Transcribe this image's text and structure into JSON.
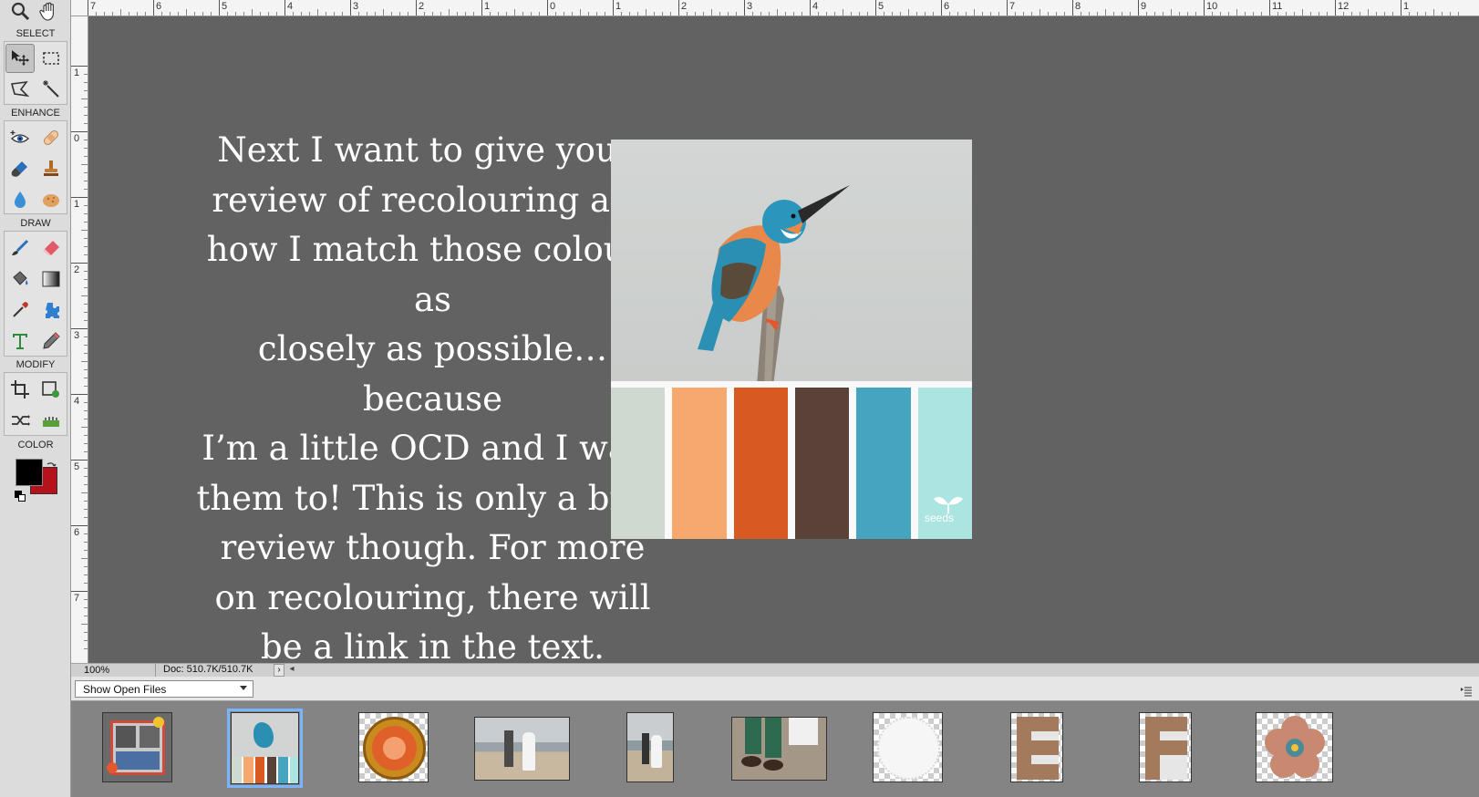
{
  "toolbox": {
    "sections": {
      "select": "SELECT",
      "enhance": "ENHANCE",
      "draw": "DRAW",
      "modify": "MODIFY",
      "color": "COLOR"
    },
    "top_tools": [
      "zoom-icon",
      "hand-icon"
    ],
    "select_tools": [
      "move-icon",
      "marquee-icon",
      "lasso-icon",
      "magic-wand-icon"
    ],
    "enhance_tools": [
      "red-eye-icon",
      "spot-healing-icon",
      "smart-brush-icon",
      "clone-stamp-icon",
      "blur-icon",
      "sponge-icon"
    ],
    "draw_tools": [
      "brush-icon",
      "eraser-icon",
      "paint-bucket-icon",
      "gradient-icon",
      "eyedropper-icon",
      "custom-shape-icon",
      "type-icon",
      "pencil-icon"
    ],
    "modify_tools": [
      "crop-icon",
      "recompose-icon",
      "content-aware-move-icon",
      "straighten-icon"
    ],
    "foreground_color": "#000000",
    "background_color": "#b5121b"
  },
  "ruler": {
    "top_labels": [
      "7",
      "6",
      "5",
      "4",
      "3",
      "2",
      "1",
      "0",
      "1",
      "2",
      "3",
      "4",
      "5",
      "6",
      "7",
      "8",
      "9",
      "10",
      "11",
      "12",
      "1"
    ],
    "left_labels": [
      "1",
      "0",
      "1",
      "2",
      "3",
      "4",
      "5",
      "6",
      "7"
    ]
  },
  "canvas": {
    "background": "#626262",
    "text_lines": [
      "Next I want to give you a",
      "review of recolouring and",
      "how I match those colours as",
      "closely as possible… because",
      "I’m a little OCD and I want",
      "them to! This is only a brief",
      "review though. For more",
      "on recolouring, there will",
      "be a link in the text."
    ],
    "palette_image": {
      "swatches": [
        "#cfd9d0",
        "#f7a86f",
        "#d85a21",
        "#5a4238",
        "#45a5c1",
        "#abe4e1"
      ],
      "watermark": "seeds"
    }
  },
  "statusbar": {
    "zoom": "100%",
    "doc": "Doc: 510.7K/510.7K"
  },
  "bin": {
    "dropdown_value": "Show Open Files",
    "thumbnails": [
      "scrapbook-layout",
      "kingfisher-palette",
      "orange-flower-button",
      "couple-beach-wide",
      "couple-beach-portrait",
      "feet-on-sand",
      "white-lace-doily",
      "wood-letter-e",
      "wood-letter-f",
      "pink-flower"
    ],
    "selected_index": 1
  }
}
